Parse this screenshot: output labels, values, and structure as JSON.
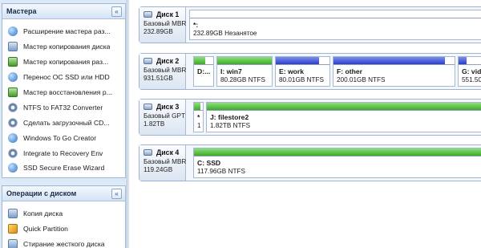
{
  "wizards_panel": {
    "title": "Мастера",
    "collapse_glyph": "«",
    "items": [
      {
        "label": "Расширение мастера раз...",
        "icon": "partition-extend-icon"
      },
      {
        "label": "Мастер копирования диска",
        "icon": "disk-copy-icon"
      },
      {
        "label": "Мастер копирования раз...",
        "icon": "partition-copy-icon"
      },
      {
        "label": "Перенос ОС SSD или HDD",
        "icon": "os-migrate-icon"
      },
      {
        "label": "Мастер восстановления р...",
        "icon": "partition-recovery-icon"
      },
      {
        "label": "NTFS to FAT32 Converter",
        "icon": "converter-icon"
      },
      {
        "label": "Сделать загрузочный CD...",
        "icon": "bootable-cd-icon"
      },
      {
        "label": "Windows To Go Creator",
        "icon": "windows-to-go-icon"
      },
      {
        "label": "Integrate to Recovery Env",
        "icon": "recovery-env-icon"
      },
      {
        "label": "SSD Secure Erase Wizard",
        "icon": "ssd-erase-icon"
      }
    ]
  },
  "disk_ops_panel": {
    "title": "Операции с диском",
    "collapse_glyph": "«",
    "items": [
      {
        "label": "Копия диска",
        "icon": "disk-copy-icon"
      },
      {
        "label": "Quick Partition",
        "icon": "quick-partition-icon"
      },
      {
        "label": "Стирание жесткого диска",
        "icon": "wipe-disk-icon"
      }
    ]
  },
  "disks": [
    {
      "title": "Диск 1",
      "type": "Базовый MBR",
      "size": "232.89GB",
      "partitions": [
        {
          "name": "*:",
          "detail": "232.89GB Незанятое",
          "used_fraction": 0,
          "color": "#ffffff"
        }
      ]
    },
    {
      "title": "Диск 2",
      "type": "Базовый MBR",
      "size": "931.51GB",
      "partitions": [
        {
          "name": "D:...",
          "detail": "",
          "used_fraction": 0.6,
          "color": "#3caa2a"
        },
        {
          "name": "I: win7",
          "detail": "80.28GB NTFS",
          "used_fraction": 1.0,
          "color": "#3caa2a"
        },
        {
          "name": "E: work",
          "detail": "80.01GB NTFS",
          "used_fraction": 0.8,
          "color": "#2c3fc4"
        },
        {
          "name": "F: other",
          "detail": "200.01GB NTFS",
          "used_fraction": 0.92,
          "color": "#2c3fc4"
        },
        {
          "name": "G: vid",
          "detail": "551.50",
          "used_fraction": 0.2,
          "color": "#2c3fc4"
        }
      ]
    },
    {
      "title": "Диск 3",
      "type": "Базовый GPT",
      "size": "1.82TB",
      "partitions": [
        {
          "name": "*",
          "detail": "1",
          "used_fraction": 0.7,
          "color": "#3caa2a"
        },
        {
          "name": "J: filestore2",
          "detail": "1.82TB NTFS",
          "used_fraction": 1.0,
          "color": "#3caa2a"
        }
      ]
    },
    {
      "title": "Диск 4",
      "type": "Базовый MBR",
      "size": "119.24GB",
      "partitions": [
        {
          "name": "C: SSD",
          "detail": "117.96GB NTFS",
          "used_fraction": 1.0,
          "color": "#3caa2a"
        }
      ]
    }
  ]
}
